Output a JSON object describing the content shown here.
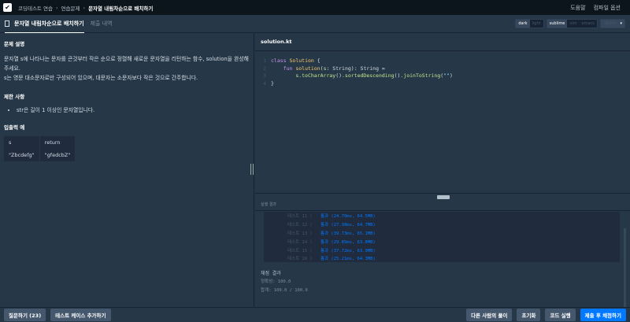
{
  "topbar": {
    "breadcrumbs": [
      "코딩테스트 연습",
      "연습문제",
      "문자열 내림차순으로 배치하기"
    ],
    "help": "도움말",
    "compile_options": "컴파일 옵션"
  },
  "tabs": [
    {
      "label": "문자열 내림차순으로 배치하기"
    },
    {
      "label": "제출 내역"
    }
  ],
  "editor_options": {
    "theme": [
      "dark",
      "light"
    ],
    "keymap": [
      "sublime",
      "vim",
      "emacs"
    ],
    "language": "Kotlin"
  },
  "problem": {
    "desc_title": "문제 설명",
    "desc": [
      "문자열 s에 나타나는 문자를 큰것부터 작은 순으로 정렬해 새로운 문자열을 리턴하는 함수, solution을 완성해주세요.",
      "s는 영문 대소문자로만 구성되어 있으며, 대문자는 소문자보다 작은 것으로 간주합니다."
    ],
    "constraints_title": "제한 사항",
    "constraints": [
      "str은 길이 1 이상인 문자열입니다."
    ],
    "io_title": "입출력 예",
    "io_headers": [
      "s",
      "return"
    ],
    "io_rows": [
      [
        "\"Zbcdefg\"",
        "\"gfedcbZ\""
      ]
    ]
  },
  "editor": {
    "filename": "solution.kt",
    "line_numbers": [
      "1",
      "2",
      "3",
      "4"
    ]
  },
  "results": {
    "title": "실행 결과",
    "rows": [
      {
        "name": "테스트 11 〉",
        "value": "통과 (24.70ms, 64.5MB)"
      },
      {
        "name": "테스트 12 〉",
        "value": "통과 (27.30ms, 64.7MB)"
      },
      {
        "name": "테스트 13 〉",
        "value": "통과 (39.73ms, 65.1MB)"
      },
      {
        "name": "테스트 14 〉",
        "value": "통과 (29.85ms, 63.8MB)"
      },
      {
        "name": "테스트 15 〉",
        "value": "통과 (37.72ms, 63.9MB)"
      },
      {
        "name": "테스트 16 〉",
        "value": "통과 (25.21ms, 64.3MB)"
      }
    ],
    "grade_title": "채점 결과",
    "accuracy": "정확성: 100.0",
    "total": "합계: 100.0 / 100.0"
  },
  "bottom": {
    "ask": "질문하기 (23)",
    "add_test": "테스트 케이스 추가하기",
    "others": "다른 사람의 풀이",
    "reset": "초기화",
    "run": "코드 실행",
    "submit": "제출 후 채점하기"
  }
}
